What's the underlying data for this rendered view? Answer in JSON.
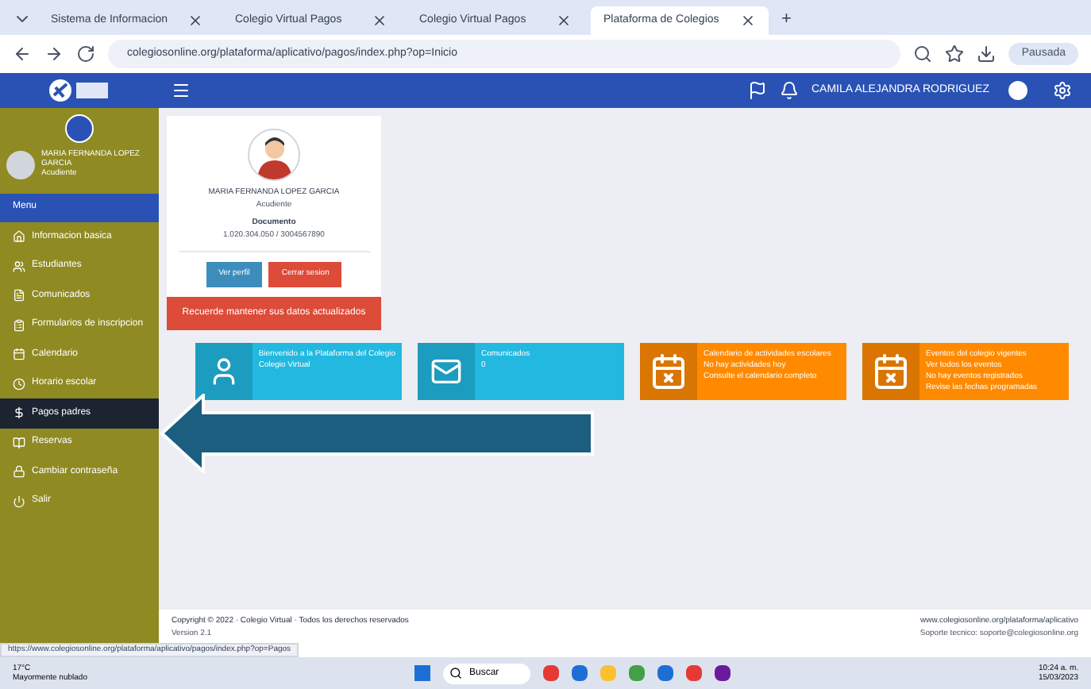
{
  "browser": {
    "tabs": [
      {
        "label": "Sistema de Informacion",
        "selected": false
      },
      {
        "label": "Colegio Virtual Pagos",
        "selected": false
      },
      {
        "label": "Colegio Virtual Pagos",
        "selected": false
      },
      {
        "label": "Plataforma de Colegios",
        "selected": true
      }
    ],
    "new_tab": "+",
    "address": "colegiosonline.org/plataforma/aplicativo/pagos/index.php?op=Inicio",
    "profile": "Pausada"
  },
  "header": {
    "user": "CAMILA ALEJANDRA RODRIGUEZ"
  },
  "sidebar": {
    "user_name": "MARIA FERNANDA LOPEZ GARCIA",
    "user_role": "Acudiente",
    "items": [
      {
        "label": "Menu",
        "kind": "heading",
        "selected": false
      },
      {
        "label": "Informacion basica",
        "kind": "item",
        "selected": false
      },
      {
        "label": "Estudiantes",
        "kind": "item",
        "selected": false
      },
      {
        "label": "Comunicados",
        "kind": "item",
        "selected": false
      },
      {
        "label": "Formularios de inscripcion",
        "kind": "item",
        "selected": false
      },
      {
        "label": "Calendario",
        "kind": "item",
        "selected": false
      },
      {
        "label": "Horario escolar",
        "kind": "item",
        "selected": false
      },
      {
        "label": "Pagos padres",
        "kind": "item",
        "selected": true
      },
      {
        "label": "Reservas",
        "kind": "item",
        "selected": false
      },
      {
        "label": "Cambiar contraseña",
        "kind": "item",
        "selected": false
      },
      {
        "label": "Salir",
        "kind": "item",
        "selected": false
      }
    ]
  },
  "profile_card": {
    "name": "MARIA FERNANDA LOPEZ GARCIA",
    "role": "Acudiente",
    "label": "Documento",
    "value": "1.020.304.050 / 3004567890",
    "buttons": [
      {
        "label": "Ver perfil",
        "kind": "primary"
      },
      {
        "label": "Cerrar sesion",
        "kind": "danger"
      }
    ],
    "alert": "Recuerde mantener sus datos actualizados"
  },
  "info_boxes": [
    {
      "kind": "user",
      "color": "#22b8e0",
      "lines": [
        "Bienvenido a la Plataforma del Colegio",
        "Colegio Virtual"
      ]
    },
    {
      "kind": "mail",
      "color": "#22b8e0",
      "lines": [
        "Comunicados",
        "0"
      ]
    },
    {
      "kind": "calendar",
      "color": "#ff8a00",
      "lines": [
        "Calendario de actividades escolares",
        "No hay actividades hoy",
        "Consulte el calendario completo"
      ]
    },
    {
      "kind": "calendar",
      "color": "#ff8a00",
      "lines": [
        "Eventos del colegio vigentes",
        "Ver todos los eventos",
        "No hay eventos registrados",
        "Revise las fechas programadas"
      ]
    }
  ],
  "footer": {
    "copyright": "Copyright © 2022 · Colegio Virtual · Todos los derechos reservados",
    "version": "Version 2.1",
    "right": "www.colegiosonline.org/plataforma/aplicativo",
    "right_sub": "Soporte tecnico: soporte@colegiosonline.org"
  },
  "status_url": "https://www.colegiosonline.org/plataforma/aplicativo/pagos/index.php?op=Pagos",
  "taskbar": {
    "weather": "17°C",
    "weather_sub": "Mayormente nublado",
    "search": "Buscar",
    "time": "10:24 a. m.",
    "date": "15/03/2023"
  }
}
